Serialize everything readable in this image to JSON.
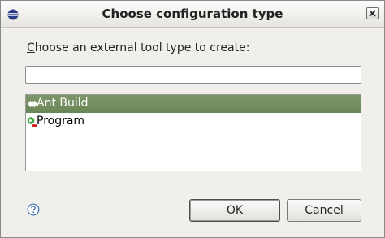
{
  "dialog": {
    "title": "Choose configuration type",
    "prompt_mnemonic": "C",
    "prompt_rest": "hoose an external tool type to create:",
    "filter": {
      "value": "",
      "placeholder": ""
    },
    "types": [
      {
        "label": "Ant Build",
        "icon": "ant-build-icon",
        "selected": true
      },
      {
        "label": "Program",
        "icon": "program-icon",
        "selected": false
      }
    ],
    "buttons": {
      "ok": "OK",
      "cancel": "Cancel"
    }
  },
  "colors": {
    "selection": "#718b5c",
    "title_bar": "#eceae5",
    "window_bg": "#f0efec"
  }
}
